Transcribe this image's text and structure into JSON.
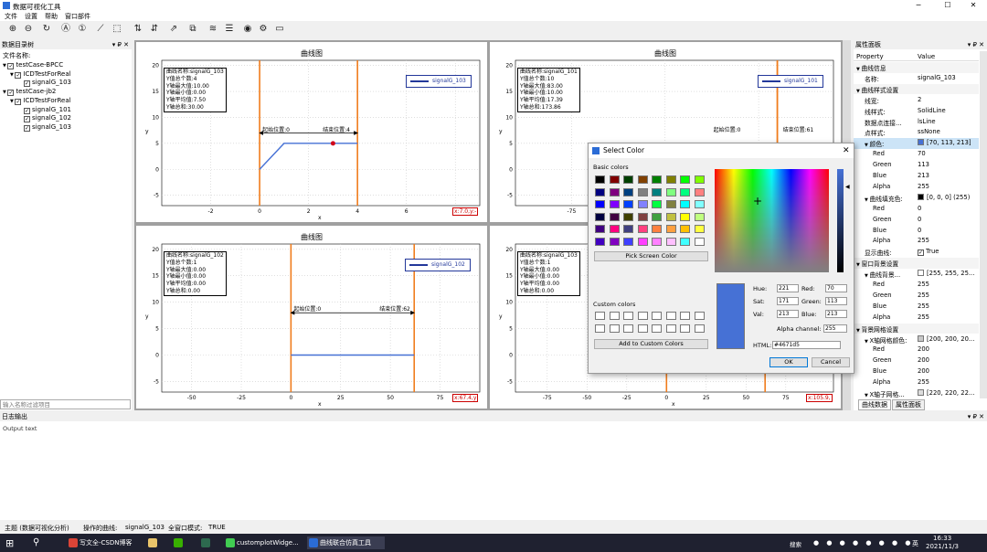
{
  "app": {
    "title": "数据可视化工具",
    "menu": [
      "文件",
      "设置",
      "帮助",
      "窗口部件"
    ],
    "win_min": "─",
    "win_max": "☐",
    "win_close": "✕"
  },
  "left_panel": {
    "title": "数据目录树",
    "pin": "▾ ₽ ✕",
    "header": "文件名称:",
    "search_placeholder": "输入名称过滤项目",
    "items": [
      {
        "label": "testCase-BPCC",
        "level": 0,
        "arrow": "▼"
      },
      {
        "label": "ICDTestForReal",
        "level": 1,
        "arrow": "▼"
      },
      {
        "label": "signalG_103",
        "level": 2,
        "arrow": ""
      },
      {
        "label": "testCase-jb2",
        "level": 0,
        "arrow": "▼"
      },
      {
        "label": "ICDTestForReal",
        "level": 1,
        "arrow": "▼"
      },
      {
        "label": "signalG_101",
        "level": 2,
        "arrow": ""
      },
      {
        "label": "signalG_102",
        "level": 2,
        "arrow": ""
      },
      {
        "label": "signalG_103",
        "level": 2,
        "arrow": ""
      }
    ]
  },
  "plots": [
    {
      "title": "曲线图",
      "legend": "signalG_103",
      "xlabel": "x",
      "ylabel": "y",
      "info": [
        "曲线名称:signalG_103",
        "Y值总个数:4",
        "Y轴最大值:10.00",
        "Y轴最小值:0.00",
        "Y轴平均值:7.50",
        "Y轴总和:30.00"
      ],
      "start_label": "起始位置:0",
      "end_label": "结束位置:4",
      "coord": "x:7.0,y:-",
      "xticks": [
        "-2",
        "0",
        "2",
        "4",
        "6",
        "8"
      ],
      "yticks": [
        "20",
        "15",
        "10",
        "5",
        "0",
        "-5"
      ]
    },
    {
      "title": "曲线图",
      "legend": "signalG_101",
      "xlabel": "x",
      "ylabel": "y",
      "info": [
        "曲线名称:signalG_101",
        "Y值总个数:10",
        "Y轴最大值:83.00",
        "Y轴最小值:10.00",
        "Y轴平均值:17.39",
        "Y轴总和:173.86"
      ],
      "start_label": "起始位置:0",
      "end_label": "结束位置:61",
      "coord": "",
      "xticks": [
        "-75",
        "-50",
        "-25"
      ],
      "yticks": [
        "20",
        "15",
        "10",
        "5",
        "0",
        "-5"
      ]
    },
    {
      "title": "曲线图",
      "legend": "signalG_102",
      "xlabel": "x",
      "ylabel": "y",
      "info": [
        "曲线名称:signalG_102",
        "Y值总个数:1",
        "Y轴最大值:0.00",
        "Y轴最小值:0.00",
        "Y轴平均值:0.00",
        "Y轴总和:0.00"
      ],
      "start_label": "起始位置:0",
      "end_label": "结束位置:62",
      "coord": "x:67.4,y",
      "xticks": [
        "-50",
        "-25",
        "0",
        "25",
        "50",
        "75"
      ],
      "yticks": [
        "20",
        "15",
        "10",
        "5",
        "0",
        "-5"
      ]
    },
    {
      "title": "曲线图",
      "legend": "signalG_103",
      "xlabel": "x",
      "ylabel": "y",
      "info": [
        "曲线名称:signalG_103",
        "Y值总个数:1",
        "Y轴最大值:0.00",
        "Y轴最小值:0.00",
        "Y轴平均值:0.00",
        "Y轴总和:0.00"
      ],
      "start_label": "",
      "end_label": "",
      "coord": "x:105.9,",
      "xticks": [
        "-75",
        "-50",
        "-25",
        "0",
        "25",
        "50",
        "75"
      ],
      "yticks": [
        "20",
        "15",
        "10",
        "5",
        "0",
        "-5"
      ]
    }
  ],
  "right_panel": {
    "title": "属性面板",
    "pin": "▾ ₽ ✕",
    "col_property": "Property",
    "col_value": "Value",
    "rows": [
      {
        "k": "曲线信息",
        "v": "",
        "lvl": 0,
        "arrow": "▼",
        "group": true
      },
      {
        "k": "名称:",
        "v": "signalG_103",
        "lvl": 1,
        "arrow": ""
      },
      {
        "k": "曲线样式设置",
        "v": "",
        "lvl": 0,
        "arrow": "▼",
        "group": true
      },
      {
        "k": "线宽:",
        "v": "2",
        "lvl": 1,
        "arrow": ""
      },
      {
        "k": "线样式:",
        "v": "SolidLine",
        "lvl": 1,
        "arrow": ""
      },
      {
        "k": "数据点连接...",
        "v": "lsLine",
        "lvl": 1,
        "arrow": ""
      },
      {
        "k": "点样式:",
        "v": "ssNone",
        "lvl": 1,
        "arrow": ""
      },
      {
        "k": "颜色:",
        "v": "[70, 113, 213]",
        "lvl": 1,
        "arrow": "▼",
        "swatch": "#4671d5",
        "sel": true
      },
      {
        "k": "Red",
        "v": "70",
        "lvl": 2,
        "arrow": ""
      },
      {
        "k": "Green",
        "v": "113",
        "lvl": 2,
        "arrow": ""
      },
      {
        "k": "Blue",
        "v": "213",
        "lvl": 2,
        "arrow": ""
      },
      {
        "k": "Alpha",
        "v": "255",
        "lvl": 2,
        "arrow": ""
      },
      {
        "k": "曲线填充色:",
        "v": "[0, 0, 0] (255)",
        "lvl": 1,
        "arrow": "▼",
        "swatch": "#000000"
      },
      {
        "k": "Red",
        "v": "0",
        "lvl": 2,
        "arrow": ""
      },
      {
        "k": "Green",
        "v": "0",
        "lvl": 2,
        "arrow": ""
      },
      {
        "k": "Blue",
        "v": "0",
        "lvl": 2,
        "arrow": ""
      },
      {
        "k": "Alpha",
        "v": "255",
        "lvl": 2,
        "arrow": ""
      },
      {
        "k": "显示曲线:",
        "v": "True",
        "lvl": 1,
        "arrow": "",
        "check": true
      },
      {
        "k": "窗口背景设置",
        "v": "",
        "lvl": 0,
        "arrow": "▼",
        "group": true
      },
      {
        "k": "曲线背景...",
        "v": "[255, 255, 25...",
        "lvl": 1,
        "arrow": "▼",
        "swatch": "#ffffff"
      },
      {
        "k": "Red",
        "v": "255",
        "lvl": 2,
        "arrow": ""
      },
      {
        "k": "Green",
        "v": "255",
        "lvl": 2,
        "arrow": ""
      },
      {
        "k": "Blue",
        "v": "255",
        "lvl": 2,
        "arrow": ""
      },
      {
        "k": "Alpha",
        "v": "255",
        "lvl": 2,
        "arrow": ""
      },
      {
        "k": "背景网格设置",
        "v": "",
        "lvl": 0,
        "arrow": "▼",
        "group": true
      },
      {
        "k": "X轴网格颜色:",
        "v": "[200, 200, 20...",
        "lvl": 1,
        "arrow": "▼",
        "swatch": "#c8c8c8"
      },
      {
        "k": "Red",
        "v": "200",
        "lvl": 2,
        "arrow": ""
      },
      {
        "k": "Green",
        "v": "200",
        "lvl": 2,
        "arrow": ""
      },
      {
        "k": "Blue",
        "v": "200",
        "lvl": 2,
        "arrow": ""
      },
      {
        "k": "Alpha",
        "v": "255",
        "lvl": 2,
        "arrow": ""
      },
      {
        "k": "X轴子网格...",
        "v": "[220, 220, 22...",
        "lvl": 1,
        "arrow": "▼",
        "swatch": "#dcdcdc"
      }
    ],
    "tabs": [
      "曲线数据",
      "属性面板"
    ]
  },
  "color_dialog": {
    "title": "Select Color",
    "basic_label": "Basic colors",
    "pick_label": "Pick Screen Color",
    "custom_label": "Custom colors",
    "add_label": "Add to Custom Colors",
    "alpha_label": "Alpha channel:",
    "alpha_value": "255",
    "html_label": "HTML:",
    "html_value": "#4671d5",
    "ok": "OK",
    "cancel": "Cancel",
    "hue_label": "Hue:",
    "hue": "221",
    "sat_label": "Sat:",
    "sat": "171",
    "val_label": "Val:",
    "val": "213",
    "red_label": "Red:",
    "red": "70",
    "green_label": "Green:",
    "green": "113",
    "blue_label": "Blue:",
    "blue": "213",
    "current_color": "#4671d5",
    "basic_colors": [
      "#000000",
      "#800000",
      "#004000",
      "#804000",
      "#008000",
      "#808000",
      "#00ff00",
      "#80ff00",
      "#000080",
      "#800080",
      "#004080",
      "#808080",
      "#008080",
      "#80ff80",
      "#00ff80",
      "#ff8080",
      "#0000ff",
      "#8000ff",
      "#0040ff",
      "#8080ff",
      "#00ff40",
      "#808040",
      "#00ffff",
      "#80ffff",
      "#000040",
      "#400040",
      "#404000",
      "#804040",
      "#40a040",
      "#c0c040",
      "#ffff00",
      "#c0ff80",
      "#400080",
      "#ff0080",
      "#404080",
      "#ff4080",
      "#ff8040",
      "#ffa040",
      "#ffc000",
      "#ffff40",
      "#4000c0",
      "#8000c0",
      "#4040ff",
      "#ff40ff",
      "#ff80ff",
      "#ffc0ff",
      "#40ffff",
      "#ffffff"
    ]
  },
  "log": {
    "title": "日志输出",
    "text": "Output text"
  },
  "status": {
    "theme": "主题 (数据可视化分析)",
    "op": "操作的曲线:",
    "op_val": "signalG_103",
    "sub": "全窗口模式:",
    "sub_val": "TRUE"
  },
  "taskbar": {
    "apps": [
      "写文全-CSDN博客 ...",
      "",
      "",
      "",
      "customplotWidge...",
      "曲线联合仿真工具"
    ],
    "lang": "英",
    "time": "16:33",
    "date": "2021/11/3",
    "tray": "搜索"
  }
}
